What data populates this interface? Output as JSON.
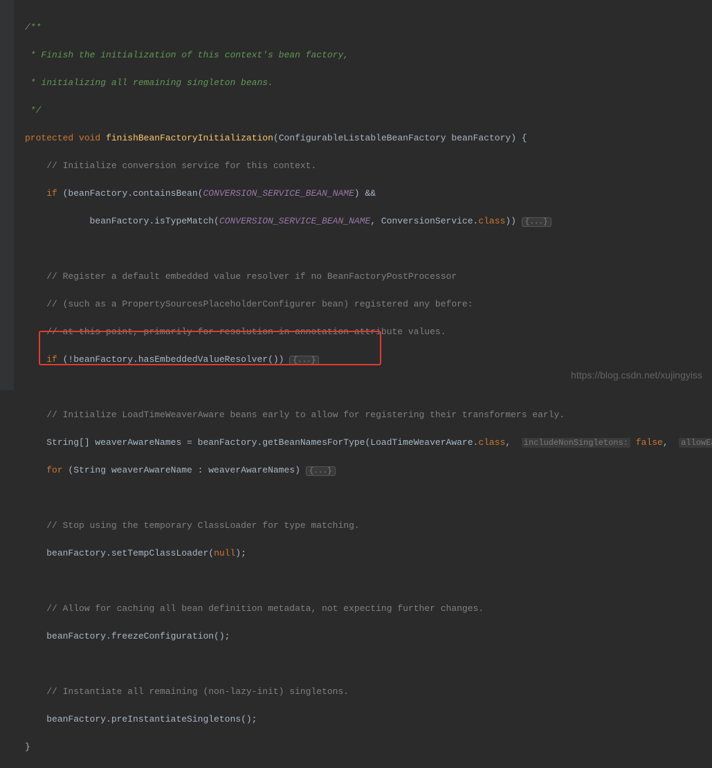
{
  "doc_comment": {
    "l1": "/**",
    "l2": " * Finish the initialization of this context's bean factory,",
    "l3": " * initializing all remaining singleton beans.",
    "l4": " */"
  },
  "method_sig": {
    "kw_protected": "protected",
    "kw_void": "void",
    "name": "finishBeanFactoryInitialization",
    "paren_open": "(",
    "param_type": "ConfigurableListableBeanFactory",
    "param_name": " beanFactory",
    "paren_close": ")",
    "brace": " {"
  },
  "c1": "// Initialize conversion service for this context.",
  "if1": {
    "kw_if": "if",
    "open": " (beanFactory.containsBean(",
    "const1": "CONVERSION_SERVICE_BEAN_NAME",
    "mid1": ") &&",
    "l2_open": "        beanFactory.isTypeMatch(",
    "const2": "CONVERSION_SERVICE_BEAN_NAME",
    "mid2": ", ConversionService.",
    "kw_class": "class",
    "close": ")) ",
    "fold": "{...}"
  },
  "c2a": "// Register a default embedded value resolver if no BeanFactoryPostProcessor",
  "c2b": "// (such as a PropertySourcesPlaceholderConfigurer bean) registered any before:",
  "c2c": "// at this point, primarily for resolution in annotation attribute values.",
  "if2": {
    "kw_if": "if",
    "body": " (!beanFactory.hasEmbeddedValueResolver()) ",
    "fold": "{...}"
  },
  "c3": "// Initialize LoadTimeWeaverAware beans early to allow for registering their transformers early.",
  "line_weaver": {
    "pre": "String[] weaverAwareNames = beanFactory.getBeanNamesForType(LoadTimeWeaverAware.",
    "kw_class": "class",
    "comma": ", ",
    "hint1": "includeNonSingletons:",
    "sp1": " ",
    "kw_false": "false",
    "comma2": ", ",
    "hint2": "allowEag"
  },
  "for1": {
    "kw_for": "for",
    "body": " (String weaverAwareName : weaverAwareNames) ",
    "fold": "{...}"
  },
  "c4": "// Stop using the temporary ClassLoader for type matching.",
  "line_temp": {
    "pre": "beanFactory.setTempClassLoader(",
    "kw_null": "null",
    "post": ");"
  },
  "c5": "// Allow for caching all bean definition metadata, not expecting further changes.",
  "line_freeze": "beanFactory.freezeConfiguration();",
  "c6": "// Instantiate all remaining (non-lazy-init) singletons.",
  "line_pre": "beanFactory.preInstantiateSingletons();",
  "close_brace": "}",
  "watermark": "https://blog.csdn.net/xujingyiss"
}
